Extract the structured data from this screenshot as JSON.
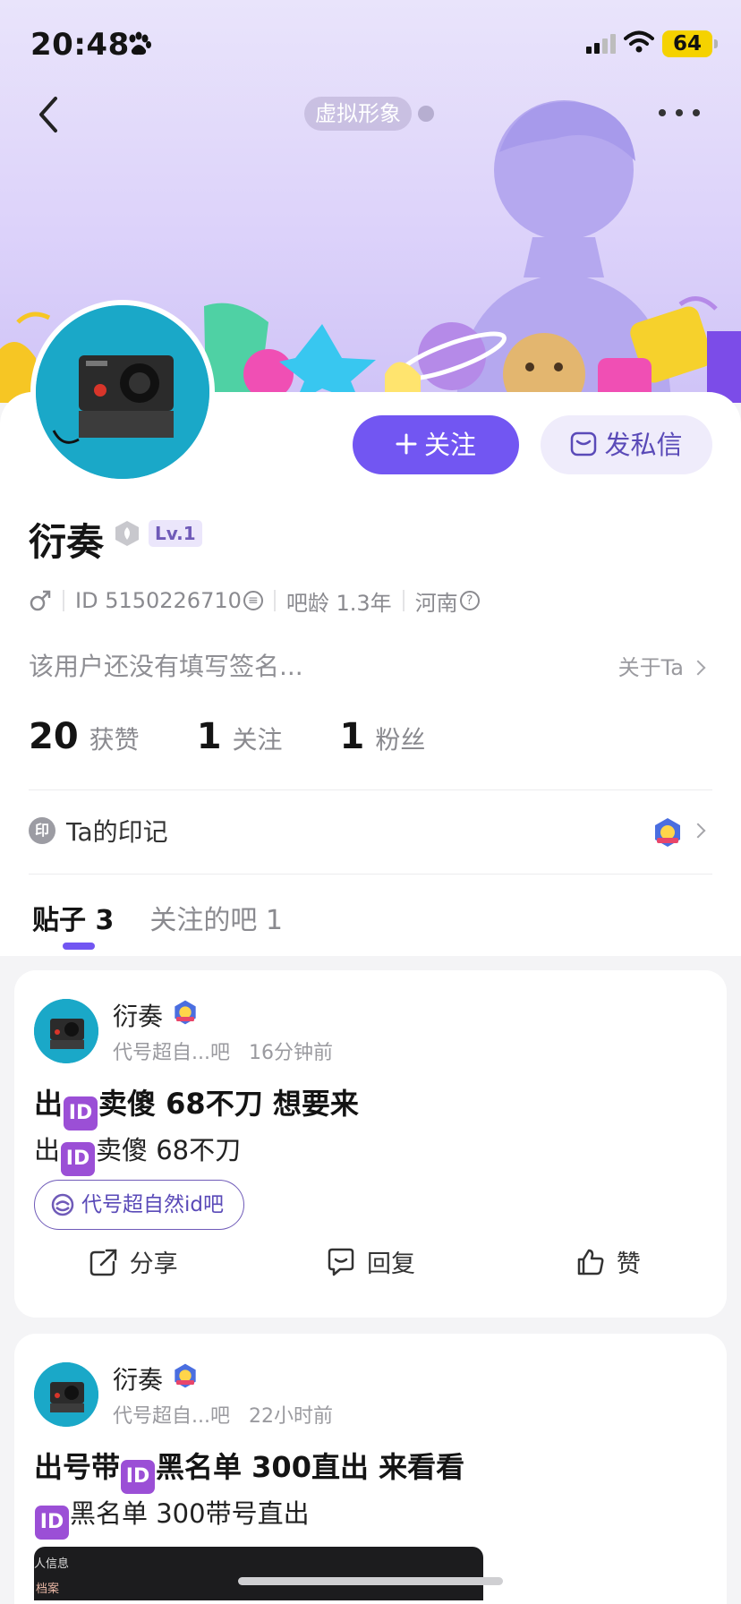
{
  "status_bar": {
    "time": "20:48",
    "battery": "64"
  },
  "header": {
    "virtual_avatar_label": "虚拟形象"
  },
  "profile": {
    "name": "衍奏",
    "level": "Lv.1",
    "id_text": "ID 5150226710",
    "bar_age": "吧龄 1.3年",
    "location": "河南",
    "signature": "该用户还没有填写签名...",
    "about_label": "关于Ta",
    "follow_button": "关注",
    "message_button": "发私信"
  },
  "stats": [
    {
      "value": "20",
      "label": "获赞"
    },
    {
      "value": "1",
      "label": "关注"
    },
    {
      "value": "1",
      "label": "粉丝"
    }
  ],
  "imprint": {
    "icon_text": "印",
    "label": "Ta的印记"
  },
  "tabs": [
    {
      "label": "贴子 3"
    },
    {
      "label": "关注的吧 1"
    }
  ],
  "posts": [
    {
      "author": "衍奏",
      "forum_short": "代号超自...吧",
      "time": "16分钟前",
      "title_pre": "出",
      "title_post": "卖傻 68不刀 想要来",
      "body_pre": "出",
      "body_post": "卖傻 68不刀",
      "forum_tag": "代号超自然id吧",
      "actions": {
        "share": "分享",
        "reply": "回复",
        "like": "赞"
      }
    },
    {
      "author": "衍奏",
      "forum_short": "代号超自...吧",
      "time": "22小时前",
      "title_pre": "出号带",
      "title_post": "黑名单 300直出 来看看",
      "body_pre": "",
      "body_post": "黑名单 300带号直出",
      "photo_caption_1": "人信息",
      "photo_caption_2": "档案"
    }
  ],
  "id_emoji_text": "ID",
  "colors": {
    "accent": "#7256f2",
    "banner": "#ddd3fa",
    "id_emoji": "#9b4fd6"
  }
}
